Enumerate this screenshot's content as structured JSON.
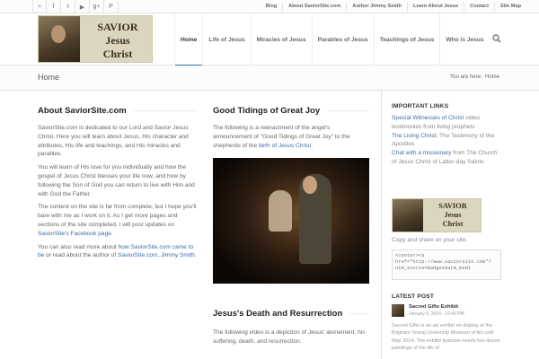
{
  "topbar": {
    "social_icons": [
      "rss-icon",
      "facebook-icon",
      "twitter-icon",
      "youtube-icon",
      "google-plus-icon",
      "pinterest-icon"
    ],
    "social_glyphs": [
      "≈",
      "f",
      "t",
      "▶",
      "g+",
      "P"
    ],
    "links": [
      "Blog",
      "About SaviorSite.com",
      "Author Jimmy Smith",
      "Learn About Jesus",
      "Contact",
      "Site Map"
    ]
  },
  "header": {
    "logo": {
      "line1": "SAVIOR",
      "line2": "Jesus",
      "line3": "Christ"
    },
    "nav": [
      "Home",
      "Life of Jesus",
      "Miracles of Jesus",
      "Parables of Jesus",
      "Teachings of Jesus",
      "Who is Jesus"
    ]
  },
  "titlebar": {
    "title": "Home",
    "crumb_prefix": "You are here:",
    "crumb_current": "Home"
  },
  "about": {
    "heading": "About SaviorSite.com",
    "p1": "SaviorSite.com is dedicated to our Lord and Savior Jesus Christ. Here you will learn about Jesus, His character and attributes, His life and teachings, and His miracles and parables.",
    "p2": "You will learn of His love for you individually and how the gospel of Jesus Christ blesses your life now, and how by following the Son of God you can return to live with Him and with God the Father.",
    "p3_a": "The content on the site is far from complete, but I hope you'll bare with me as I work on it. As I get more pages and sections of the site completed, I will post updates on ",
    "p3_link": "SaviorSite's Facebook page",
    "p3_b": ".",
    "p4_a": "You can also read more about ",
    "p4_link1": "how SaviorSite.com came to be",
    "p4_b": " or read about the author of ",
    "p4_link2": "SaviorSite.com, Jimmy Smith",
    "p4_c": "."
  },
  "tidings": {
    "heading": "Good Tidings of Great Joy",
    "p_a": "The following is a reenactment of the angel's announcement of \"Good Tidings of Great Joy\" to the shepherds of the ",
    "p_link": "birth of Jesus Christ",
    "p_b": "."
  },
  "death": {
    "heading": "Jesus's Death and Resurrection",
    "p": "The following video is a depiction of Jesus' atonement, his suffering, death, and resurrection."
  },
  "sidebar": {
    "links_heading": "IMPORTANT LINKS",
    "l1_link": "Special Witnesses of Christ",
    "l1_text": " video testimonies from living prophets",
    "l2_link": "The Living Christ",
    "l2_text": ": The Testimony of the Apostles",
    "l3_link": "Chat with a missionary",
    "l3_text": " from The Church of Jesus Christ of Latter-day Saints",
    "logo": {
      "line1": "SAVIOR",
      "line2": "Jesus",
      "line3": "Christ"
    },
    "share_text": "Copy and share on your site.",
    "code": "<center><a href=\"http://www.saviorsite.com\"?utm_source=Badges&utm_medi",
    "latest_heading": "LATEST POST",
    "post_title": "Sacred Gifts Exhibit",
    "post_date": "January 5, 2014 - 10:40 PM",
    "post_excerpt": "Sacred Gifts is an art exhibit on display at the Brigham Young University Museum of Art until May 2014. The exhibit features nearly two dozen paintings of the life of"
  }
}
